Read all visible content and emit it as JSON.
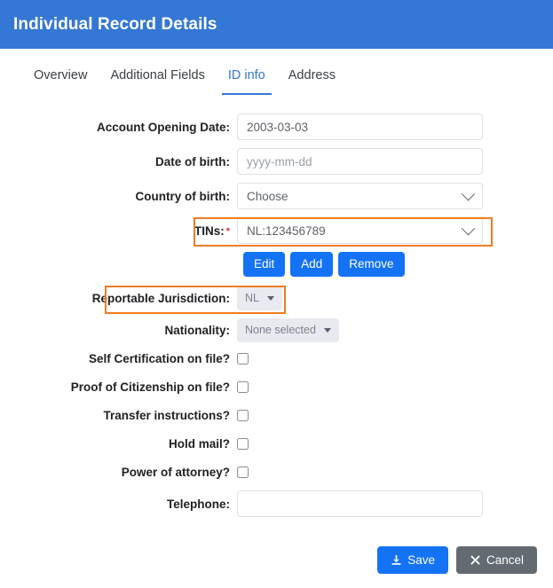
{
  "header": {
    "title": "Individual Record Details",
    "bg_color": "#3577d4"
  },
  "tabs": {
    "active_index": 2,
    "items": [
      {
        "label": "Overview"
      },
      {
        "label": "Additional Fields"
      },
      {
        "label": "ID info"
      },
      {
        "label": "Address"
      }
    ],
    "active_color": "#3577d4"
  },
  "highlight": {
    "color": "#f07c22"
  },
  "form": {
    "account_opening_date": {
      "label": "Account Opening Date:",
      "value": "2003-03-03",
      "placeholder": ""
    },
    "date_of_birth": {
      "label": "Date of birth:",
      "value": "",
      "placeholder": "yyyy-mm-dd"
    },
    "country_of_birth": {
      "label": "Country of birth:",
      "value": "Choose"
    },
    "tins": {
      "label": "TINs:",
      "required_mark": "*",
      "value": "NL:123456789"
    },
    "tin_actions": {
      "edit_label": "Edit",
      "add_label": "Add",
      "remove_label": "Remove"
    },
    "reportable_jurisdiction": {
      "label": "Reportable Jurisdiction:",
      "value": "NL"
    },
    "nationality": {
      "label": "Nationality:",
      "value": "None selected"
    },
    "checkboxes": [
      {
        "label": "Self Certification on file?",
        "checked": false
      },
      {
        "label": "Proof of Citizenship on file?",
        "checked": false
      },
      {
        "label": "Transfer instructions?",
        "checked": false
      },
      {
        "label": "Hold mail?",
        "checked": false
      },
      {
        "label": "Power of attorney?",
        "checked": false
      }
    ],
    "telephone": {
      "label": "Telephone:",
      "value": "",
      "placeholder": ""
    }
  },
  "footer": {
    "save_label": "Save",
    "cancel_label": "Cancel",
    "save_color": "#1472f5",
    "cancel_color": "#636a72"
  }
}
